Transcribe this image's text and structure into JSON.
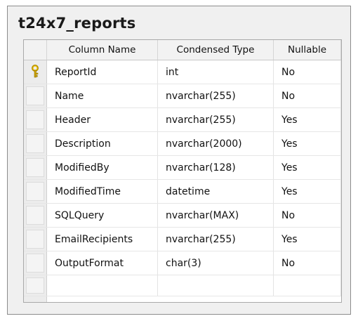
{
  "table": {
    "title": "t24x7_reports",
    "columns": {
      "name": "Column Name",
      "type": "Condensed Type",
      "nullable": "Nullable"
    },
    "rows": [
      {
        "name": "ReportId",
        "type": "int",
        "nullable": "No",
        "primary_key": true,
        "icon": "primary-key-icon"
      },
      {
        "name": "Name",
        "type": "nvarchar(255)",
        "nullable": "No"
      },
      {
        "name": "Header",
        "type": "nvarchar(255)",
        "nullable": "Yes"
      },
      {
        "name": "Description",
        "type": "nvarchar(2000)",
        "nullable": "Yes"
      },
      {
        "name": "ModifiedBy",
        "type": "nvarchar(128)",
        "nullable": "Yes"
      },
      {
        "name": "ModifiedTime",
        "type": "datetime",
        "nullable": "Yes"
      },
      {
        "name": "SQLQuery",
        "type": "nvarchar(MAX)",
        "nullable": "No"
      },
      {
        "name": "EmailRecipients",
        "type": "nvarchar(255)",
        "nullable": "Yes"
      },
      {
        "name": "OutputFormat",
        "type": "char(3)",
        "nullable": "No"
      }
    ]
  },
  "colors": {
    "window_background": "#f0f0f0",
    "grid_background": "#ffffff",
    "key_icon": "#e6b800"
  }
}
